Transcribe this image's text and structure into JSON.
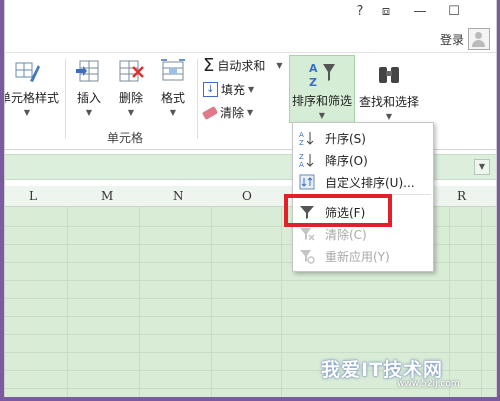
{
  "titlebar": {
    "help": "?",
    "restore": "⧈",
    "minimize": "—",
    "maximize": "☐"
  },
  "account": {
    "login": "登录"
  },
  "ribbon": {
    "cell_styles": "单元格样式",
    "insert": "插入",
    "delete": "删除",
    "format": "格式",
    "group_cells": "单元格",
    "autosum": "自动求和",
    "fill": "填充",
    "clear": "清除",
    "sort_filter": "排序和筛选",
    "find_select": "查找和选择"
  },
  "columns": [
    "L",
    "M",
    "N",
    "O",
    "R"
  ],
  "menu": {
    "items": [
      {
        "label": "升序(S)",
        "enabled": true
      },
      {
        "label": "降序(O)",
        "enabled": true
      },
      {
        "label": "自定义排序(U)...",
        "enabled": true
      },
      {
        "label": "筛选(F)",
        "enabled": true
      },
      {
        "label": "清除(C)",
        "enabled": false
      },
      {
        "label": "重新应用(Y)",
        "enabled": false
      }
    ]
  },
  "watermark": {
    "text": "我爱IT技术网",
    "url": "www.52ij.com"
  },
  "colors": {
    "accent_green": "#217346",
    "sheet_bg": "#d9ecd6",
    "highlight_red": "#e3202a"
  }
}
